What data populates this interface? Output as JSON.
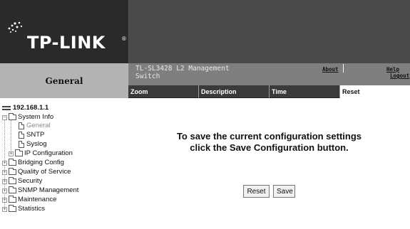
{
  "header": {
    "brand": "TP-LINK",
    "reg_mark": "®",
    "section_title": "General",
    "device_title": "TL-SL3428 L2 Management Switch",
    "links": {
      "about": "About",
      "help": "Help",
      "logout": "Logout"
    }
  },
  "tabs": [
    {
      "label": "Zoom"
    },
    {
      "label": "Description"
    },
    {
      "label": "Time"
    },
    {
      "label": "Reset"
    }
  ],
  "active_tab": "Reset",
  "tree": {
    "root": "192.168.1.1",
    "items": [
      {
        "label": "System Info"
      },
      {
        "label": "General"
      },
      {
        "label": "SNTP"
      },
      {
        "label": "Syslog"
      },
      {
        "label": "IP Configuration"
      },
      {
        "label": "Bridging Config"
      },
      {
        "label": "Quality of Service"
      },
      {
        "label": "Security"
      },
      {
        "label": "SNMP Management"
      },
      {
        "label": "Maintenance"
      },
      {
        "label": "Statistics"
      }
    ]
  },
  "main": {
    "message_line1": "To save the current configuration settings",
    "message_line2": "click the Save Configuration button.",
    "reset_label": "Reset",
    "save_label": "Save"
  }
}
